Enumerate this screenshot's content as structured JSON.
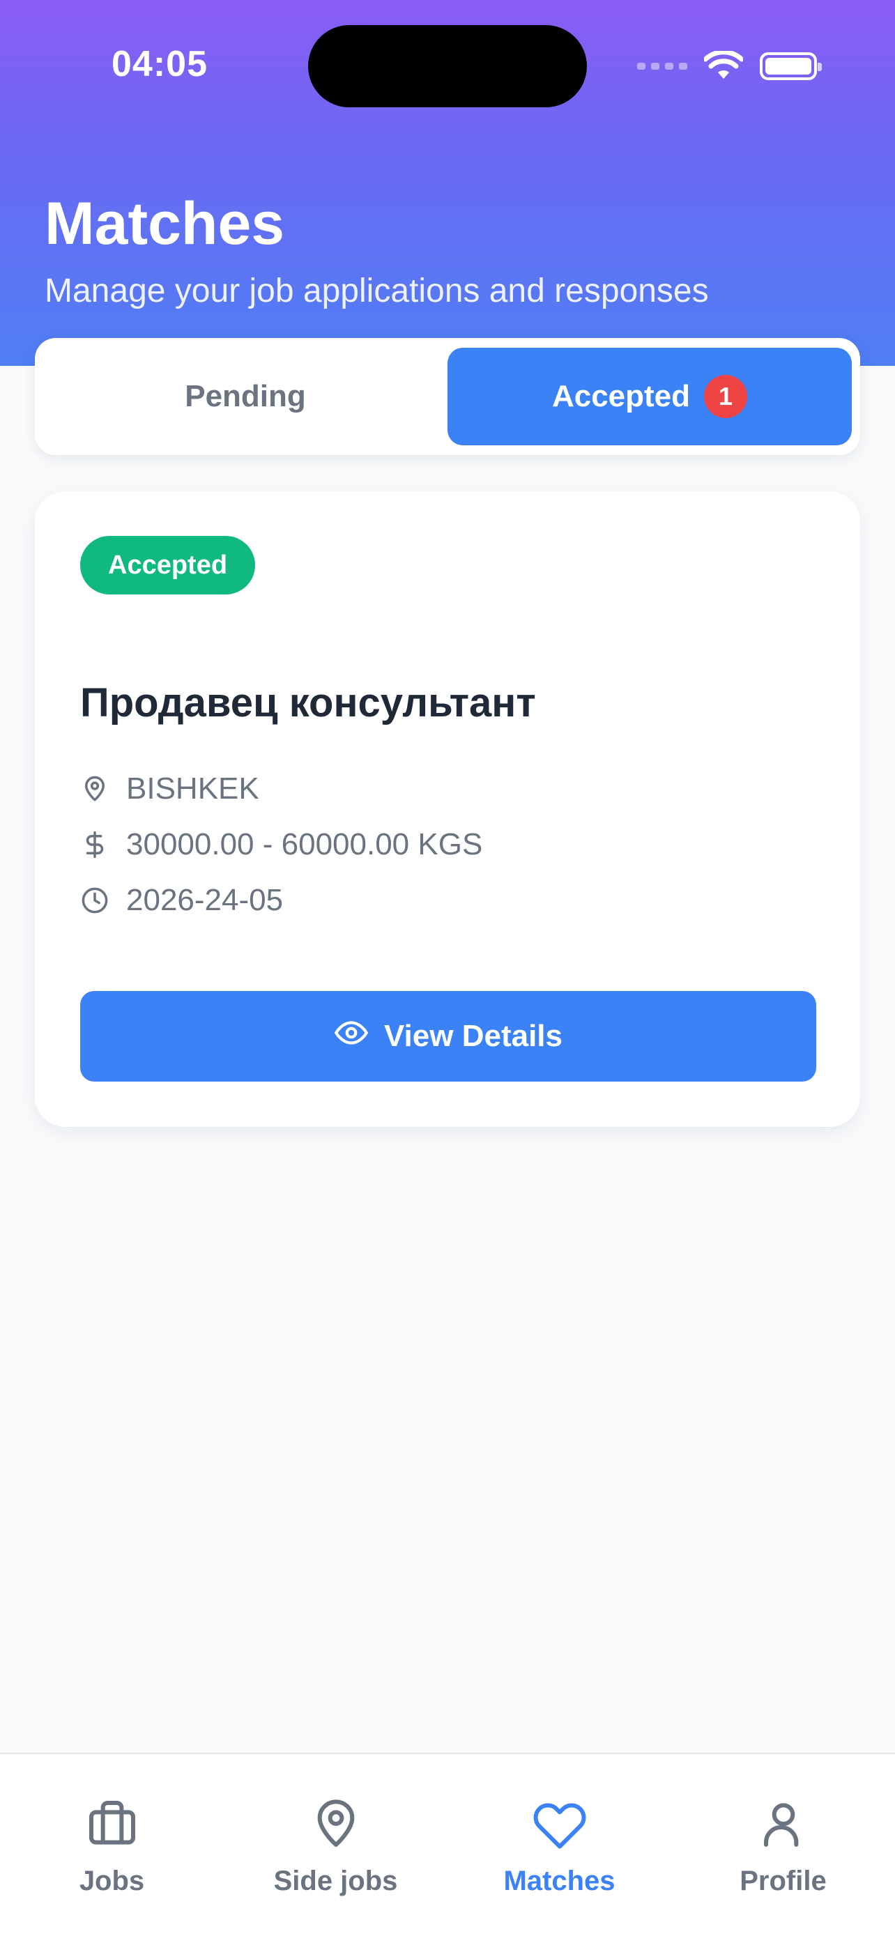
{
  "status_bar": {
    "time": "04:05"
  },
  "header": {
    "title": "Matches",
    "subtitle": "Manage your job applications and responses"
  },
  "tabs": [
    {
      "label": "Pending",
      "active": false
    },
    {
      "label": "Accepted",
      "active": true,
      "badge": "1"
    }
  ],
  "card": {
    "status": "Accepted",
    "title": "Продавец консультант",
    "location": "BISHKEK",
    "salary": "30000.00 - 60000.00 KGS",
    "date": "2026-24-05",
    "button_label": "View Details"
  },
  "bottom_nav": [
    {
      "label": "Jobs",
      "icon": "briefcase-icon",
      "active": false
    },
    {
      "label": "Side jobs",
      "icon": "map-pin-icon",
      "active": false
    },
    {
      "label": "Matches",
      "icon": "heart-icon",
      "active": true
    },
    {
      "label": "Profile",
      "icon": "user-icon",
      "active": false
    }
  ],
  "colors": {
    "primary": "#3b82f6",
    "success": "#10b981",
    "danger": "#ef4444",
    "header_gradient_top": "#8b5cf6",
    "header_gradient_bottom": "#4f7ef4"
  }
}
